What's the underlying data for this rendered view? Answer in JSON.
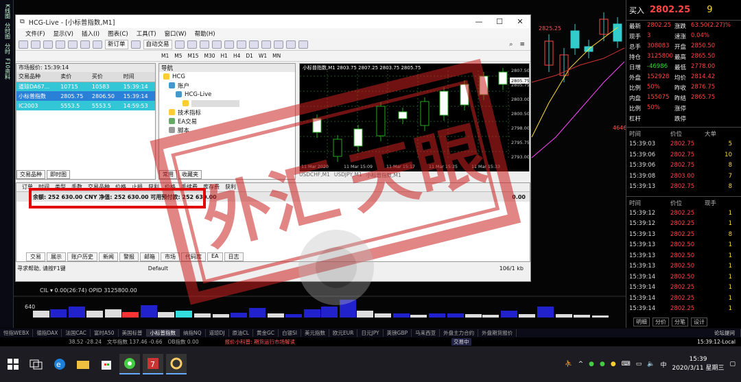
{
  "left_strip": [
    "K线图",
    "分时图",
    "分时",
    "F10资料"
  ],
  "window": {
    "title": "HCG-Live - [小标普指数,M1]",
    "menu": [
      "文件(F)",
      "显示(V)",
      "插入(I)",
      "图表(C)",
      "工具(T)",
      "窗口(W)",
      "帮助(H)"
    ],
    "toolbar": {
      "new_order": "新订单",
      "auto_trade": "自动交易"
    },
    "timeframes": [
      "M1",
      "M5",
      "M15",
      "M30",
      "H1",
      "H4",
      "D1",
      "W1",
      "MN"
    ]
  },
  "market_watch": {
    "title": "市场报价: 15:39:14",
    "columns": [
      "交易品种",
      "卖价",
      "买价",
      "时间"
    ],
    "rows": [
      {
        "symbol": "道琼DA67...",
        "bid": "10715",
        "ask": "10583",
        "time": "15:39:14"
      },
      {
        "symbol": "小标普指数",
        "bid": "2805.75",
        "ask": "2806.50",
        "time": "15:39:14"
      },
      {
        "symbol": "IC2003",
        "bid": "5553.5",
        "ask": "5553.5",
        "time": "14:59:53"
      }
    ],
    "tabs": [
      "交易品种",
      "即时图"
    ]
  },
  "navigator": {
    "title": "导航",
    "items": [
      "HCG",
      "账户",
      "HCG-Live",
      "技术指标",
      "EA交易",
      "脚本"
    ],
    "tabs": [
      "常用",
      "收藏夹"
    ]
  },
  "chart": {
    "symbol_line": "小标普指数,M1  2803.75 2807.25 2803.75 2805.75",
    "prices": [
      "2807.50",
      "2805.75",
      "2803.00",
      "2800.50",
      "2798.00",
      "2795.75",
      "2793.00"
    ],
    "current_price": "2805.75",
    "dates": [
      "11 Mar 2020",
      "11 Mar 15:09",
      "11 Mar 15:17",
      "11 Mar 15:25",
      "11 Mar 15:33"
    ],
    "tabs": [
      "USDCHF,M1",
      "USDJPY,M1",
      "小标普指数,M1"
    ]
  },
  "terminal": {
    "columns": [
      "订单",
      "时间",
      "类型",
      "手数",
      "交易品种",
      "价格",
      "止损",
      "获利",
      "价格",
      "手续费",
      "库存费",
      "获利"
    ],
    "balance_line": "余额: 252 630.00 CNY  净值: 252 630.00  可用预付款: 252 630.00",
    "profit": "0.00",
    "tabs": [
      "交易",
      "展示",
      "账户历史",
      "新闻",
      "警报",
      "邮箱",
      "市场",
      "代码库",
      "EA",
      "日志"
    ]
  },
  "status": {
    "help": "寻求帮助, 请按F1键",
    "profile": "Default",
    "traffic": "106/1 kb"
  },
  "quote_panel": {
    "buy_label": "买入",
    "buy_price": "2802.25",
    "buy_volume": "9",
    "stats": [
      [
        "最新",
        "2802.25",
        "涨跌",
        "63.50(2.27)%"
      ],
      [
        "现手",
        "3",
        "速涨",
        "0.04%"
      ],
      [
        "总手",
        "308083",
        "开盘",
        "2850.50"
      ],
      [
        "持仓",
        "3125800",
        "最高",
        "2865.50"
      ],
      [
        "日增",
        "-46986",
        "最低",
        "2778.00"
      ],
      [
        "外盘",
        "152928",
        "均价",
        "2814.42"
      ],
      [
        "比例",
        "50%",
        "昨收",
        "2876.75"
      ],
      [
        "内盘",
        "155075",
        "昨结",
        "2865.75"
      ],
      [
        "比例",
        "50%",
        "涨停",
        ""
      ],
      [
        "杠杆",
        "",
        "跌停",
        ""
      ]
    ],
    "ticks1_head": [
      "时间",
      "价位",
      "大单"
    ],
    "ticks1": [
      [
        "15:39:03",
        "2802.75",
        "5"
      ],
      [
        "15:39:06",
        "2802.75",
        "10"
      ],
      [
        "15:39:06",
        "2802.75",
        "8"
      ],
      [
        "15:39:08",
        "2803.00",
        "7"
      ],
      [
        "15:39:13",
        "2802.75",
        "8"
      ]
    ],
    "ticks2_head": [
      "时间",
      "价位",
      "现手"
    ],
    "ticks2": [
      [
        "15:39:12",
        "2802.25",
        "1"
      ],
      [
        "15:39:12",
        "2802.25",
        "1"
      ],
      [
        "15:39:13",
        "2802.25",
        "8"
      ],
      [
        "15:39:13",
        "2802.50",
        "1"
      ],
      [
        "15:39:13",
        "2802.50",
        "1"
      ],
      [
        "15:39:13",
        "2802.50",
        "1"
      ],
      [
        "15:39:14",
        "2802.50",
        "1"
      ],
      [
        "15:39:14",
        "2802.25",
        "1"
      ],
      [
        "15:39:14",
        "2802.25",
        "1"
      ],
      [
        "15:39:14",
        "2802.25",
        "1"
      ]
    ],
    "bottom_tabs": [
      "明细",
      "分价",
      "分笔",
      "设计"
    ]
  },
  "volume": {
    "label": "CIL ▾  0.00(26:74)  OPID 3125800.00",
    "level": "640"
  },
  "background_axis": {
    "price": "2825.25",
    "mark": "4646"
  },
  "symbol_tabs": [
    "恒指WEBX",
    "德指DAX",
    "法国CAC",
    "富时A50",
    "美国标普",
    "小标普指数",
    "纳指NQ",
    "道琼DJ",
    "原油CL",
    "黄金GC",
    "白银SI",
    "美元指数",
    "欧元EUR",
    "日元JPY",
    "英镑GBP",
    "马来西亚",
    "外盘主力合约",
    "外盘期货报价"
  ],
  "symbol_tabs_active": 5,
  "help_link": "论坛提问",
  "ticker": {
    "items": [
      "38.52 -28.24",
      "文华指数 137.46 -0.66",
      "OB指数 0.00"
    ],
    "announcement": "报价小科普: 期货运行市场解读",
    "session": "交易中",
    "clock": "15:39:12-Local"
  },
  "taskbar": {
    "time": "15:39",
    "date": "2020/3/11 星期三"
  },
  "stamp_text": [
    "外",
    "汇",
    "天",
    "眼"
  ],
  "colors": {
    "bull": "#ffffff",
    "bear": "#22aa22",
    "ma_line": "#cc3333",
    "accent": "#e00000"
  }
}
